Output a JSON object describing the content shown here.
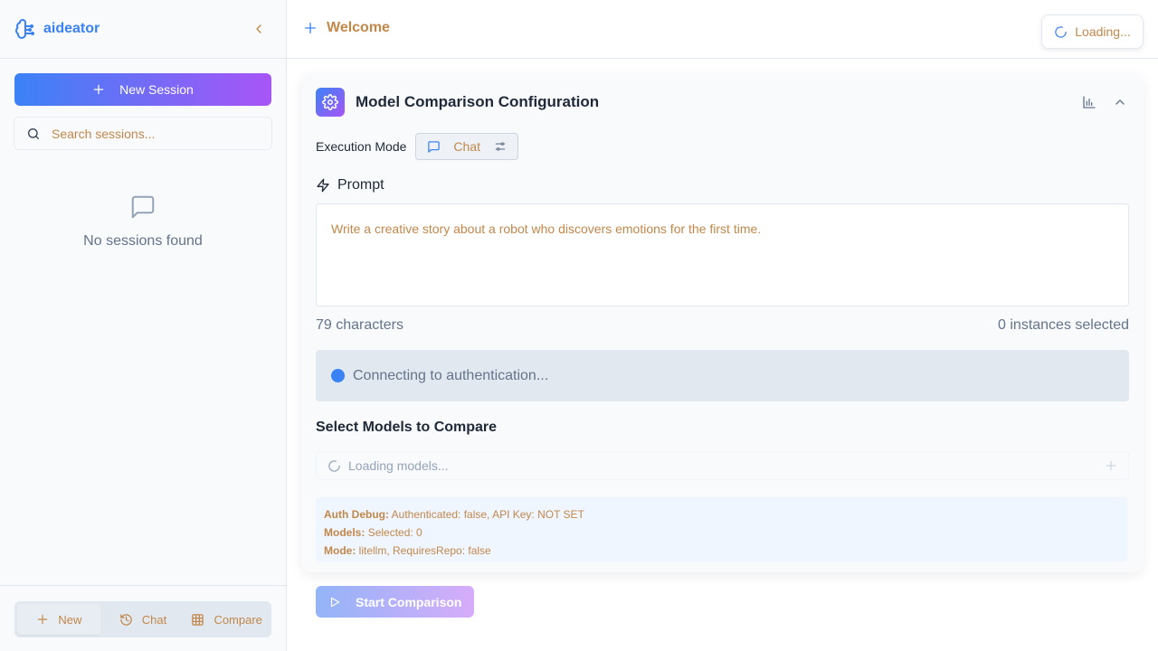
{
  "sidebar": {
    "app_name": "aideator",
    "new_session_label": "New Session",
    "search_placeholder": "Search sessions...",
    "empty_text": "No sessions found",
    "footer_tabs": [
      {
        "label": "New",
        "icon": "plus-icon",
        "active": true
      },
      {
        "label": "Chat",
        "icon": "history-icon",
        "active": false
      },
      {
        "label": "Compare",
        "icon": "grid-icon",
        "active": false
      }
    ]
  },
  "topbar": {
    "title": "Welcome",
    "loading_label": "Loading..."
  },
  "card": {
    "title": "Model Comparison Configuration",
    "execution_mode_label": "Execution Mode",
    "execution_mode_value": "Chat",
    "prompt_label": "Prompt",
    "prompt_text": "Write a creative story about a robot who discovers emotions for the first time.",
    "char_count": "79 characters",
    "instances_selected": "0 instances selected",
    "auth_status": "Connecting to authentication...",
    "select_models_title": "Select Models to Compare",
    "models_loading": "Loading models...",
    "debug": {
      "auth_label": "Auth Debug:",
      "auth_value": "Authenticated: false, API Key: NOT SET",
      "models_label": "Models:",
      "models_value": "Selected: 0",
      "mode_label": "Mode:",
      "mode_value": "litellm, RequiresRepo: false"
    }
  },
  "start_button_label": "Start Comparison",
  "colors": {
    "accent": "#3b82f6",
    "gradient_end": "#a855f7",
    "muted_text": "#c2874a"
  }
}
